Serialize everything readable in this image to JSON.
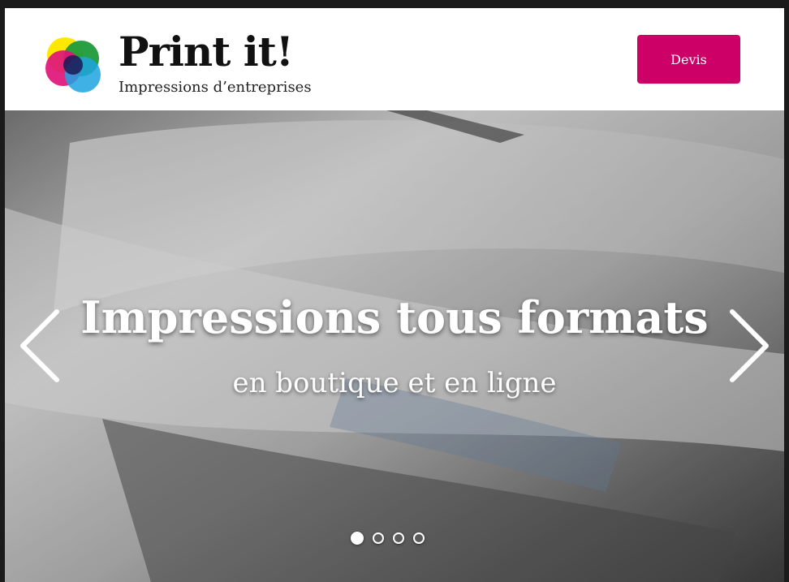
{
  "header": {
    "brand_title": "Print it!",
    "brand_tagline": "Impressions d’entreprises",
    "devis_label": "Devis"
  },
  "colors": {
    "accent": "#cc0066",
    "logo_cyan": "#1fa3e0",
    "logo_magenta": "#e0137a",
    "logo_yellow": "#ffe800",
    "logo_green": "#1f9a3c"
  },
  "hero": {
    "title": "Impressions tous formats",
    "subtitle": "en boutique et en ligne",
    "slide_count": 4,
    "active_slide": 1
  },
  "icons": {
    "prev": "chevron-left-icon",
    "next": "chevron-right-icon"
  }
}
